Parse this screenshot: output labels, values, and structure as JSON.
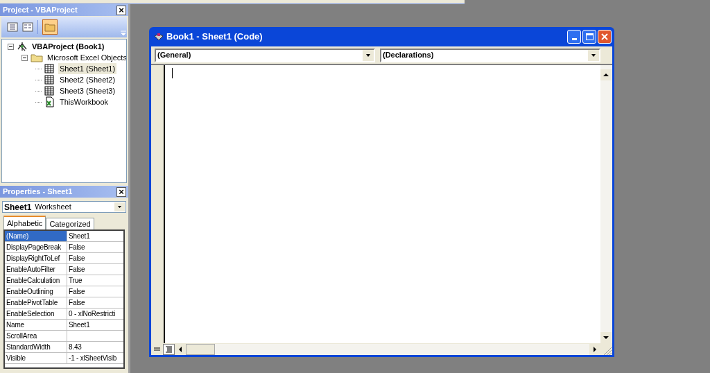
{
  "project": {
    "title": "Project - VBAProject",
    "close": "×",
    "tree": [
      {
        "label": "VBAProject (Book1)",
        "kind": "project",
        "expanded": true,
        "selected": false,
        "children": [
          {
            "label": "Microsoft Excel Objects",
            "kind": "folder",
            "expanded": true,
            "selected": false,
            "children": [
              {
                "label": "Sheet1 (Sheet1)",
                "kind": "sheet",
                "selected": true
              },
              {
                "label": "Sheet2 (Sheet2)",
                "kind": "sheet",
                "selected": false
              },
              {
                "label": "Sheet3 (Sheet3)",
                "kind": "sheet",
                "selected": false
              },
              {
                "label": "ThisWorkbook",
                "kind": "workbook",
                "selected": false
              }
            ]
          }
        ]
      }
    ]
  },
  "properties": {
    "title": "Properties - Sheet1",
    "close": "×",
    "object_name": "Sheet1",
    "object_type": "Worksheet",
    "tabs": [
      {
        "label": "Alphabetic",
        "selected": true
      },
      {
        "label": "Categorized",
        "selected": false
      }
    ],
    "rows": [
      {
        "name": "(Name)",
        "value": "Sheet1",
        "selected": true
      },
      {
        "name": "DisplayPageBreak",
        "value": "False",
        "selected": false
      },
      {
        "name": "DisplayRightToLef",
        "value": "False",
        "selected": false
      },
      {
        "name": "EnableAutoFilter",
        "value": "False",
        "selected": false
      },
      {
        "name": "EnableCalculation",
        "value": "True",
        "selected": false
      },
      {
        "name": "EnableOutlining",
        "value": "False",
        "selected": false
      },
      {
        "name": "EnablePivotTable",
        "value": "False",
        "selected": false
      },
      {
        "name": "EnableSelection",
        "value": "0 - xlNoRestricti",
        "selected": false
      },
      {
        "name": "Name",
        "value": "Sheet1",
        "selected": false
      },
      {
        "name": "ScrollArea",
        "value": "",
        "selected": false
      },
      {
        "name": "StandardWidth",
        "value": "8.43",
        "selected": false
      },
      {
        "name": "Visible",
        "value": "-1 - xlSheetVisib",
        "selected": false
      }
    ]
  },
  "code_window": {
    "title": "Book1 - Sheet1 (Code)",
    "object_combo": "(General)",
    "procedure_combo": "(Declarations)",
    "view_buttons": [
      {
        "kind": "procedure",
        "selected": false
      },
      {
        "kind": "module",
        "selected": true
      }
    ]
  }
}
